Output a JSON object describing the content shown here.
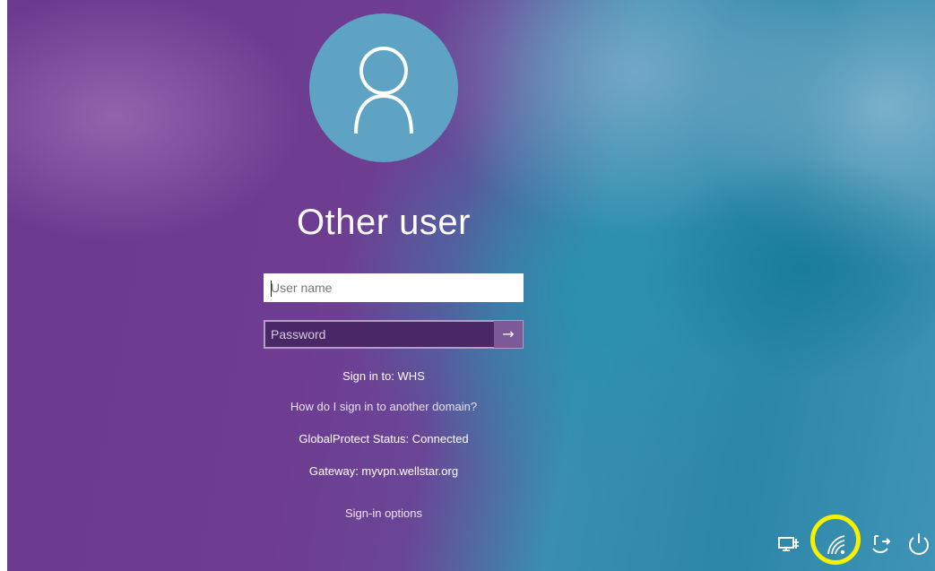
{
  "login": {
    "username_title": "Other user",
    "username_field": {
      "placeholder": "User name",
      "value": ""
    },
    "password_field": {
      "placeholder": "Password",
      "value": ""
    },
    "submit_glyph": "→"
  },
  "info": {
    "sign_in_to": "Sign in to: WHS",
    "other_domain_link": "How do I sign in to another domain?",
    "globalprotect_status": "GlobalProtect Status: Connected",
    "gateway": "Gateway: myvpn.wellstar.org",
    "sign_in_options": "Sign-in options"
  },
  "tray": {
    "icons": [
      "network-connect-icon",
      "wifi-icon",
      "accessibility-icon",
      "power-icon"
    ]
  },
  "colors": {
    "highlight": "#f5f000",
    "avatar_bg": "#5ea3c4"
  }
}
